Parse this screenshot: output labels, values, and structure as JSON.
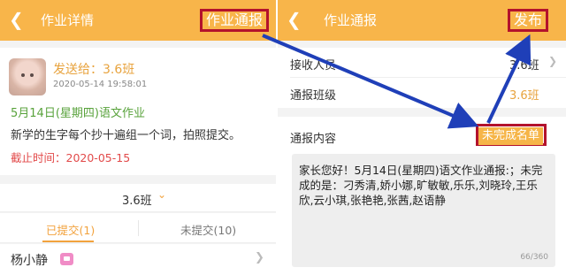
{
  "left": {
    "header": {
      "back_icon": "chevron-left-icon",
      "title": "作业详情",
      "action_label": "作业通报"
    },
    "card": {
      "send_to": "发送给：3.6班",
      "send_time": "2020-05-14 19:58:01",
      "homework_title": "5月14日(星期四)语文作业",
      "homework_desc": "新学的生字每个抄十遍组一个词，拍照提交。",
      "deadline": "截止时间：2020-05-15"
    },
    "class_selector": {
      "label": "3.6班",
      "icon": "chevron-down-icon"
    },
    "tabs": [
      {
        "label": "已提交(1)"
      },
      {
        "label": "未提交(10)"
      }
    ],
    "students": [
      {
        "name": "杨小静",
        "badge_icon": "image-badge-icon"
      }
    ]
  },
  "right": {
    "header": {
      "back_icon": "chevron-left-icon",
      "title": "作业通报",
      "action_label": "发布"
    },
    "receiver": {
      "label": "接收人员",
      "value": "3.6班"
    },
    "report_class": {
      "label": "通报班级",
      "value": "3.6班"
    },
    "content": {
      "label": "通报内容",
      "tag_button": "未完成名单",
      "text": "家长您好！5月14日(星期四)语文作业通报:；未完成的是：刁秀清,娇小娜,旷敏敏,乐乐,刘晓玲,王乐欣,云小琪,张艳艳,张茜,赵语静",
      "counter": "66/360"
    }
  },
  "colors": {
    "header": "#f8b54a",
    "highlight": "#b3122c",
    "arrow": "#1f3fb8",
    "accent": "#f2a23d",
    "deadline": "#e24a4a",
    "title_green": "#58a23b"
  }
}
